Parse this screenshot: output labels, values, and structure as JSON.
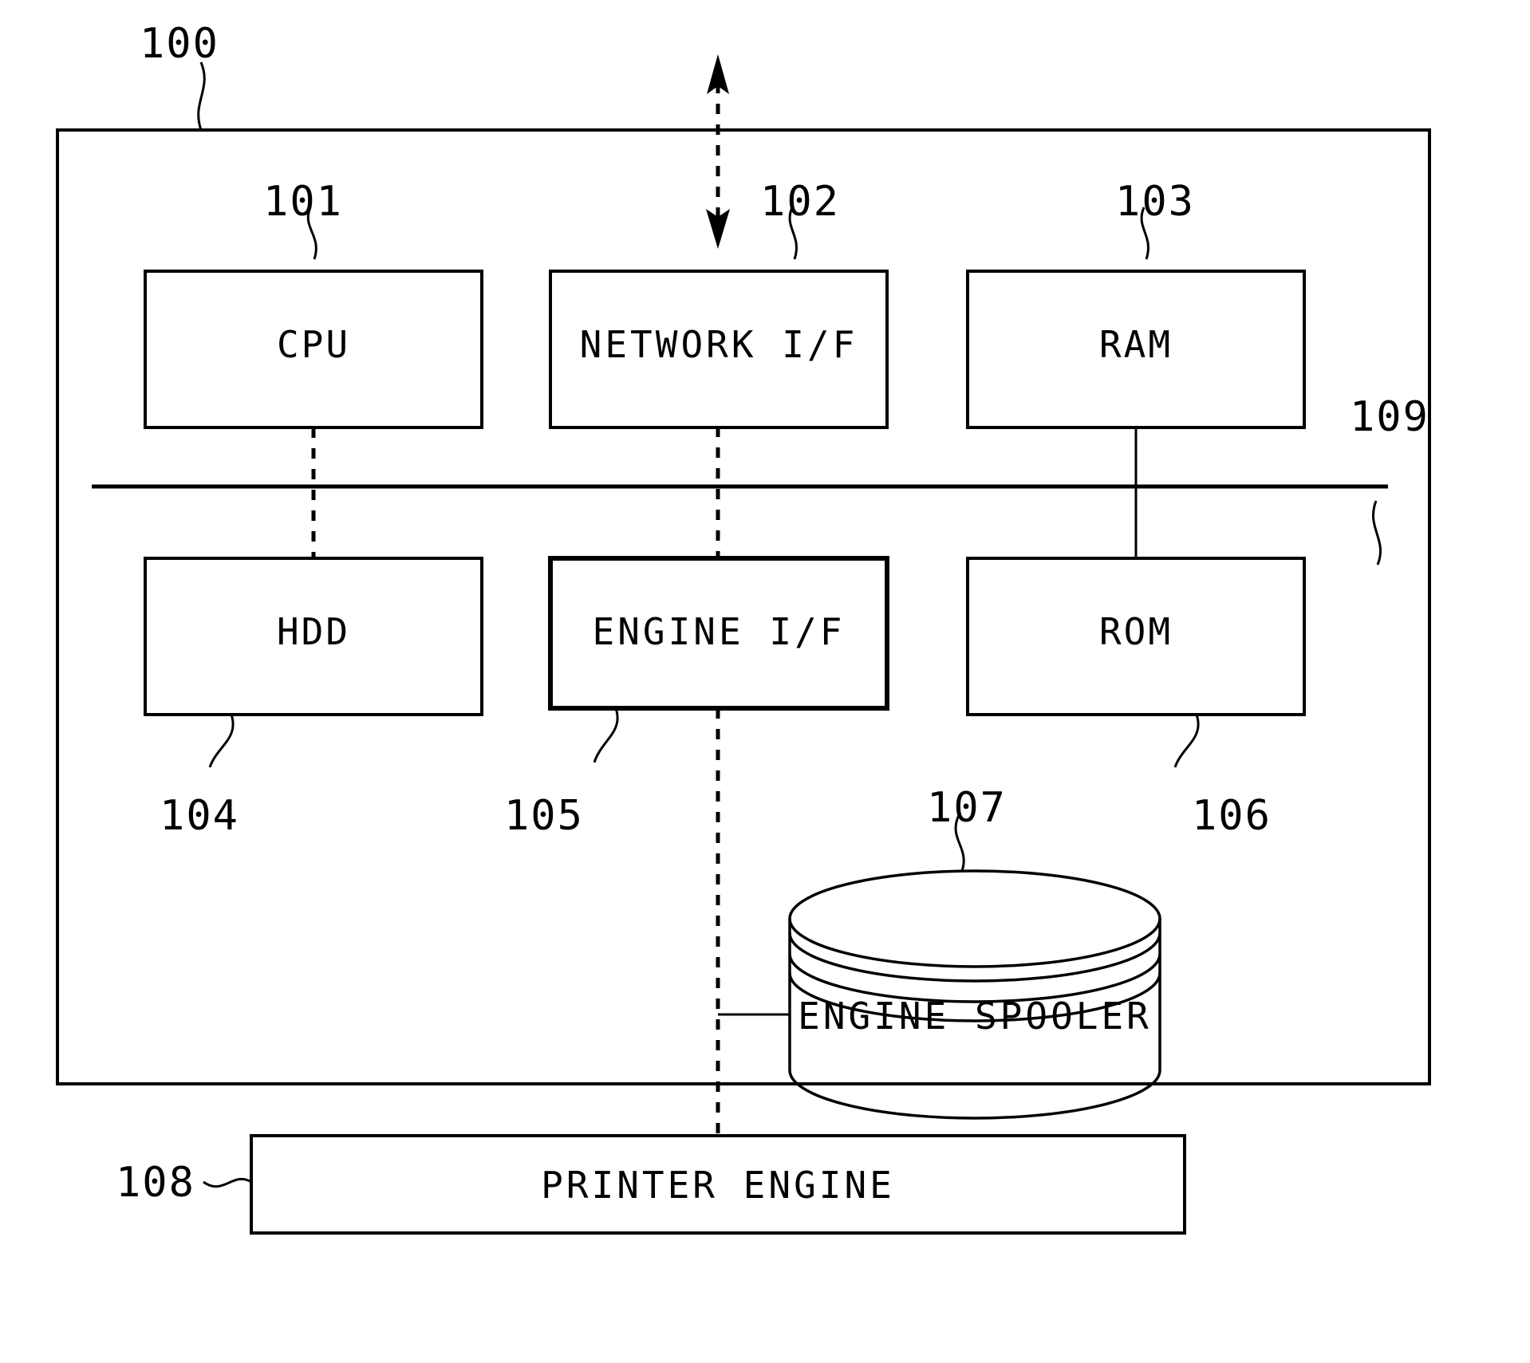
{
  "figure": {
    "kind": "patent-block-diagram",
    "title": "Printer controller block diagram",
    "background_color": "#ffffff",
    "line_color": "#000000"
  },
  "outer_enclosure": {
    "reference_numeral": "100",
    "name": "printing-apparatus-enclosure"
  },
  "bus": {
    "reference_numeral": "109",
    "name": "system-bus"
  },
  "blocks": [
    {
      "id": "cpu",
      "label": "CPU",
      "reference_numeral": "101",
      "numeral_position": "above",
      "border": "normal"
    },
    {
      "id": "network_if",
      "label": "NETWORK I/F",
      "reference_numeral": "102",
      "numeral_position": "above",
      "border": "normal"
    },
    {
      "id": "ram",
      "label": "RAM",
      "reference_numeral": "103",
      "numeral_position": "above",
      "border": "normal"
    },
    {
      "id": "hdd",
      "label": "HDD",
      "reference_numeral": "104",
      "numeral_position": "below",
      "border": "normal"
    },
    {
      "id": "engine_if",
      "label": "ENGINE I/F",
      "reference_numeral": "105",
      "numeral_position": "below",
      "border": "thick"
    },
    {
      "id": "rom",
      "label": "ROM",
      "reference_numeral": "106",
      "numeral_position": "below",
      "border": "normal"
    },
    {
      "id": "engine_spooler",
      "label": "ENGINE SPOOLER",
      "reference_numeral": "107",
      "numeral_position": "above",
      "border": "cylinder"
    },
    {
      "id": "printer_engine",
      "label": "PRINTER ENGINE",
      "reference_numeral": "108",
      "numeral_position": "left",
      "border": "normal"
    }
  ],
  "connections": [
    {
      "from": "external-network",
      "to": "network_if",
      "style": "dashed",
      "arrows": "both"
    },
    {
      "from": "cpu",
      "to": "hdd",
      "style": "dashed",
      "arrows": "none"
    },
    {
      "from": "ram",
      "to": "rom",
      "style": "solid",
      "arrows": "none"
    },
    {
      "from": "engine_if",
      "to": "engine_spooler",
      "style": "solid",
      "arrows": "none"
    },
    {
      "from": "engine_if",
      "to": "printer_engine",
      "style": "dashed",
      "arrows": "none"
    }
  ]
}
